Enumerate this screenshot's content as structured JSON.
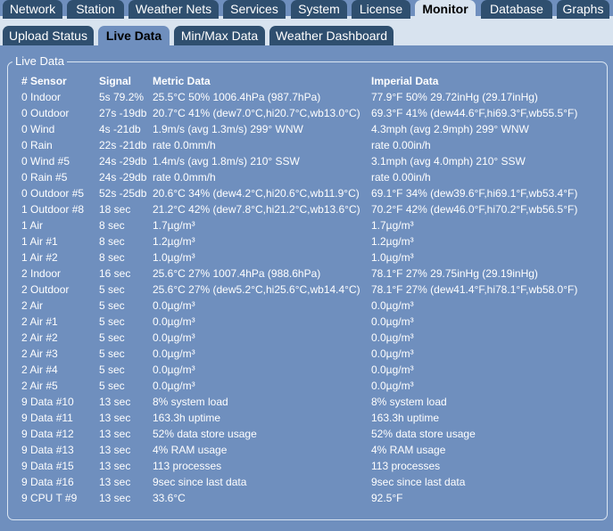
{
  "main_tabs": [
    {
      "label": "Network",
      "active": false
    },
    {
      "label": "Station",
      "active": false
    },
    {
      "label": "Weather Nets",
      "active": false
    },
    {
      "label": "Services",
      "active": false
    },
    {
      "label": "System",
      "active": false
    },
    {
      "label": "License",
      "active": false
    },
    {
      "label": "Monitor",
      "active": true
    },
    {
      "label": "Database",
      "active": false
    },
    {
      "label": "Graphs",
      "active": false
    }
  ],
  "sub_tabs": [
    {
      "label": "Upload Status",
      "active": false
    },
    {
      "label": "Live Data",
      "active": true
    },
    {
      "label": "Min/Max Data",
      "active": false
    },
    {
      "label": "Weather Dashboard",
      "active": false
    }
  ],
  "panel": {
    "legend": "Live Data",
    "headers": [
      "# Sensor",
      "Signal",
      "Metric Data",
      "Imperial Data"
    ],
    "rows": [
      [
        "0 Indoor",
        "5s 79.2%",
        "25.5°C 50% 1006.4hPa (987.7hPa)",
        "77.9°F 50% 29.72inHg (29.17inHg)"
      ],
      [
        "0 Outdoor",
        "27s -19db",
        "20.7°C 41% (dew7.0°C,hi20.7°C,wb13.0°C)",
        "69.3°F 41% (dew44.6°F,hi69.3°F,wb55.5°F)"
      ],
      [
        "0 Wind",
        "4s -21db",
        "1.9m/s (avg 1.3m/s) 299° WNW",
        "4.3mph (avg 2.9mph) 299° WNW"
      ],
      [
        "0 Rain",
        "22s -21db",
        "rate 0.0mm/h",
        "rate 0.00in/h"
      ],
      [
        "0 Wind #5",
        "24s -29db",
        "1.4m/s (avg 1.8m/s) 210° SSW",
        "3.1mph (avg 4.0mph) 210° SSW"
      ],
      [
        "0 Rain #5",
        "24s -29db",
        "rate 0.0mm/h",
        "rate 0.00in/h"
      ],
      [
        "0 Outdoor #5",
        "52s -25db",
        "20.6°C 34% (dew4.2°C,hi20.6°C,wb11.9°C)",
        "69.1°F 34% (dew39.6°F,hi69.1°F,wb53.4°F)"
      ],
      [
        "1 Outdoor #8",
        "18 sec",
        "21.2°C 42% (dew7.8°C,hi21.2°C,wb13.6°C)",
        "70.2°F 42% (dew46.0°F,hi70.2°F,wb56.5°F)"
      ],
      [
        "1 Air",
        "8 sec",
        "1.7µg/m³",
        "1.7µg/m³"
      ],
      [
        "1 Air #1",
        "8 sec",
        "1.2µg/m³",
        "1.2µg/m³"
      ],
      [
        "1 Air #2",
        "8 sec",
        "1.0µg/m³",
        "1.0µg/m³"
      ],
      [
        "2 Indoor",
        "16 sec",
        "25.6°C 27% 1007.4hPa (988.6hPa)",
        "78.1°F 27% 29.75inHg (29.19inHg)"
      ],
      [
        "2 Outdoor",
        "5 sec",
        "25.6°C 27% (dew5.2°C,hi25.6°C,wb14.4°C)",
        "78.1°F 27% (dew41.4°F,hi78.1°F,wb58.0°F)"
      ],
      [
        "2 Air",
        "5 sec",
        "0.0µg/m³",
        "0.0µg/m³"
      ],
      [
        "2 Air #1",
        "5 sec",
        "0.0µg/m³",
        "0.0µg/m³"
      ],
      [
        "2 Air #2",
        "5 sec",
        "0.0µg/m³",
        "0.0µg/m³"
      ],
      [
        "2 Air #3",
        "5 sec",
        "0.0µg/m³",
        "0.0µg/m³"
      ],
      [
        "2 Air #4",
        "5 sec",
        "0.0µg/m³",
        "0.0µg/m³"
      ],
      [
        "2 Air #5",
        "5 sec",
        "0.0µg/m³",
        "0.0µg/m³"
      ],
      [
        "9 Data #10",
        "13 sec",
        "8% system load",
        "8% system load"
      ],
      [
        "9 Data #11",
        "13 sec",
        "163.3h uptime",
        "163.3h uptime"
      ],
      [
        "9 Data #12",
        "13 sec",
        "52% data store usage",
        "52% data store usage"
      ],
      [
        "9 Data #13",
        "13 sec",
        "4% RAM usage",
        "4% RAM usage"
      ],
      [
        "9 Data #15",
        "13 sec",
        "113 processes",
        "113 processes"
      ],
      [
        "9 Data #16",
        "13 sec",
        "9sec since last data",
        "9sec since last data"
      ],
      [
        "9 CPU T #9",
        "13 sec",
        "33.6°C",
        "92.5°F"
      ]
    ]
  }
}
